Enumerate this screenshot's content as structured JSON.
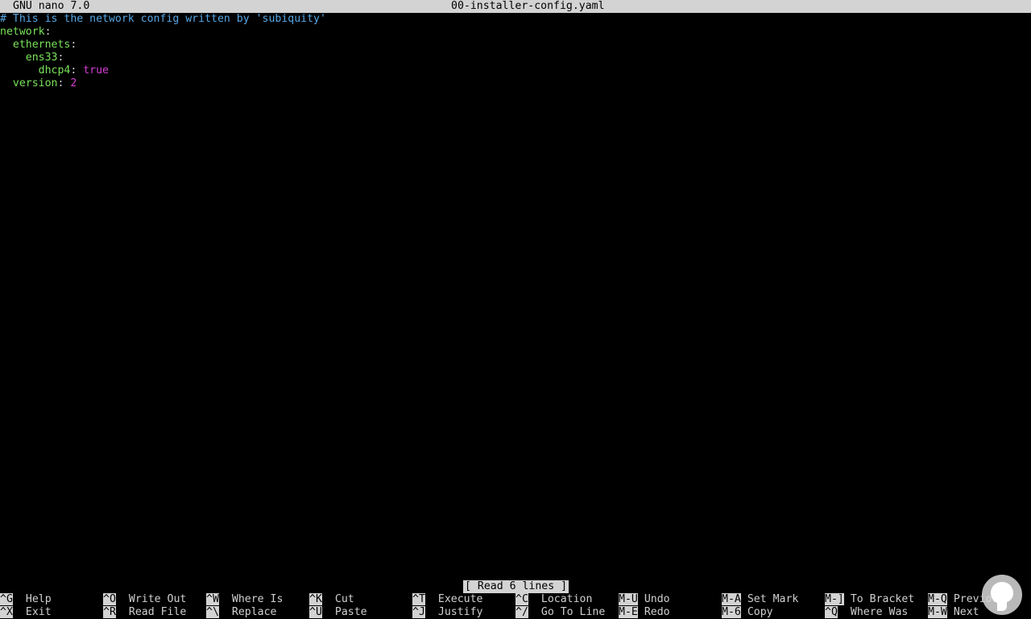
{
  "titlebar": {
    "app": "GNU nano 7.0",
    "filename": "00-installer-config.yaml"
  },
  "editor": {
    "comment": "# This is the network config written by 'subiquity'",
    "l1_key": "network",
    "l2_key": "ethernets",
    "l3_key": "ens33",
    "l4_key": "dhcp4",
    "l4_value": "true",
    "l5_key": "version",
    "l5_value": "2"
  },
  "status": "[ Read 6 lines ]",
  "shortcuts_row1": [
    {
      "key": "^G",
      "label": "Help"
    },
    {
      "key": "^O",
      "label": "Write Out"
    },
    {
      "key": "^W",
      "label": "Where Is"
    },
    {
      "key": "^K",
      "label": "Cut"
    },
    {
      "key": "^T",
      "label": "Execute"
    },
    {
      "key": "^C",
      "label": "Location"
    },
    {
      "key": "M-U",
      "label": "Undo"
    },
    {
      "key": "M-A",
      "label": "Set Mark"
    },
    {
      "key": "M-]",
      "label": "To Bracket"
    },
    {
      "key": "M-Q",
      "label": "Previous"
    }
  ],
  "shortcuts_row2": [
    {
      "key": "^X",
      "label": "Exit"
    },
    {
      "key": "^R",
      "label": "Read File"
    },
    {
      "key": "^\\",
      "label": "Replace"
    },
    {
      "key": "^U",
      "label": "Paste"
    },
    {
      "key": "^J",
      "label": "Justify"
    },
    {
      "key": "^/",
      "label": "Go To Line"
    },
    {
      "key": "M-E",
      "label": "Redo"
    },
    {
      "key": "M-6",
      "label": "Copy"
    },
    {
      "key": "^Q",
      "label": "Where Was"
    },
    {
      "key": "M-W",
      "label": "Next"
    }
  ],
  "colors": {
    "comment": "#56a7e5",
    "key": "#79e35a",
    "value": "#d63fd6",
    "bar": "#d3d3d3"
  },
  "logo_icon": "person-head-logo-icon"
}
